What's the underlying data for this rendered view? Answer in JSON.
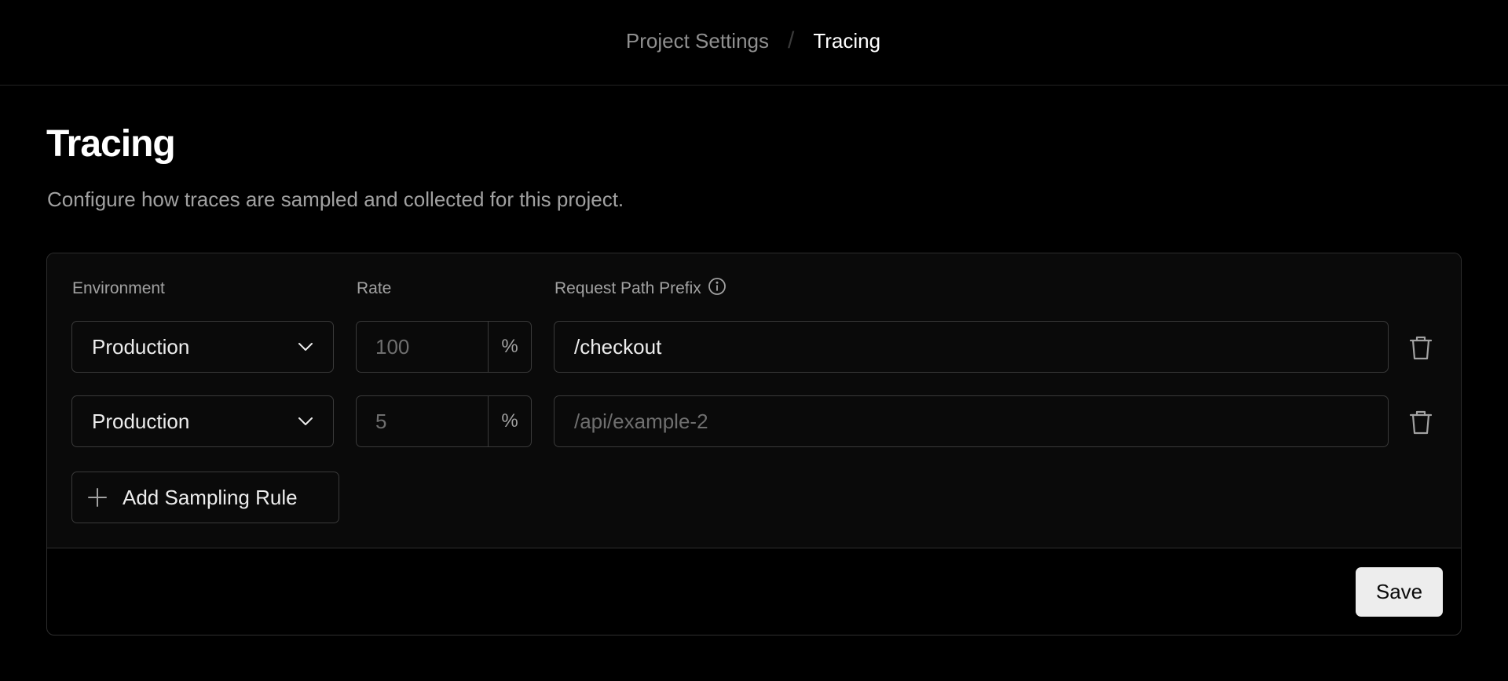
{
  "breadcrumb": {
    "parent": "Project Settings",
    "separator": "/",
    "current": "Tracing"
  },
  "header": {
    "title": "Tracing",
    "description": "Configure how traces are sampled and collected for this project."
  },
  "table": {
    "columns": {
      "environment": "Environment",
      "rate": "Rate",
      "path_prefix": "Request Path Prefix"
    },
    "rows": [
      {
        "environment": "Production",
        "rate_value": "100",
        "rate_suffix": "%",
        "path_value": "/checkout",
        "path_placeholder": ""
      },
      {
        "environment": "Production",
        "rate_value": "5",
        "rate_suffix": "%",
        "path_value": "",
        "path_placeholder": "/api/example-2"
      }
    ],
    "add_rule_label": "Add Sampling Rule"
  },
  "footer": {
    "save_label": "Save"
  },
  "icons": {
    "info": "info-icon",
    "chevron": "chevron-down-icon",
    "trash": "trash-icon",
    "plus": "plus-icon"
  },
  "colors": {
    "background": "#000000",
    "card": "#0a0a0a",
    "border": "#2e2e2e",
    "text_primary": "#ededed",
    "text_muted": "#a1a1a1",
    "button_primary_bg": "#ededed"
  }
}
